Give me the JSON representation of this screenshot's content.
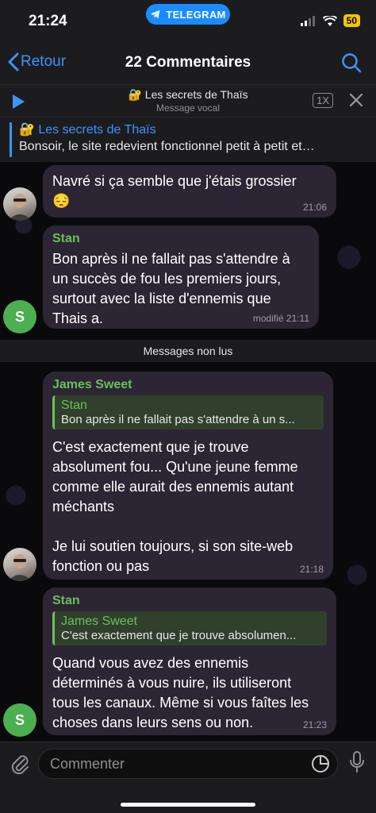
{
  "status": {
    "time": "21:24",
    "app_pill": "TELEGRAM",
    "battery": "50"
  },
  "nav": {
    "back_label": "Retour",
    "title": "22 Commentaires"
  },
  "audio": {
    "title": "🔐 Les secrets de Thaïs",
    "subtitle": "Message vocal",
    "speed": "1X"
  },
  "pinned": {
    "title": "🔐 Les secrets de Thaïs",
    "text": "Bonsoir, le site redevient fonctionnel petit à petit et…"
  },
  "messages": [
    {
      "text": "Navré si ça semble que j'étais grossier\n😔",
      "time": "21:06"
    },
    {
      "sender": "Stan",
      "avatar_letter": "S",
      "text": "Bon après il ne fallait pas s'attendre à\nun succès de fou les premiers jours,\nsurtout avec la liste d'ennemis que\nThais a.",
      "time": "modifié 21:11"
    },
    {
      "sender": "James Sweet",
      "quote_name": "Stan",
      "quote_text": "Bon après il ne fallait pas s'attendre à un s...",
      "text": "C'est exactement que je trouve\nabsolument fou... Qu'une jeune femme\ncomme elle aurait des ennemis autant\nméchants\n\nJe lui soutien toujours, si son site-web\nfonction ou pas",
      "time": "21:18"
    },
    {
      "sender": "Stan",
      "avatar_letter": "S",
      "quote_name": "James Sweet",
      "quote_text": "C'est exactement que je trouve absolumen...",
      "text": "Quand vous avez des ennemis\ndéterminés à vous nuire, ils utiliseront\ntous les canaux. Même si vous faîtes les\nchoses dans leurs sens ou non.",
      "time": "21:23"
    }
  ],
  "unread_label": "Messages non lus",
  "composer": {
    "placeholder": "Commenter"
  },
  "colors": {
    "accent": "#3e93ff",
    "sender_name": "#6bbf5b",
    "bubble": "#2c2533"
  }
}
